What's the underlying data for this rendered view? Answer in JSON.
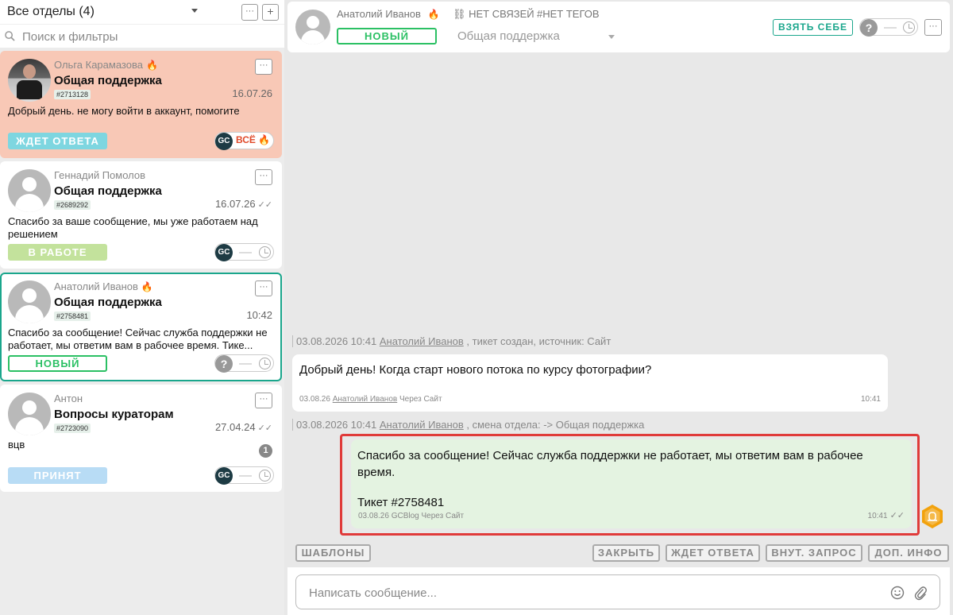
{
  "sidebar": {
    "title": "Все отделы (4)",
    "more_label": "···",
    "add_label": "+",
    "search_placeholder": "Поиск и фильтры"
  },
  "tickets": [
    {
      "name": "Ольга Карамазова",
      "subject": "Общая поддержка",
      "ticket_id": "#2713128",
      "date": "16.07.26",
      "message": "Добрый день. не могу войти в аккаунт, помогите",
      "status": "ЖДЕТ ОТВЕТА",
      "assignee_initials": "GC",
      "assignee_tag": "ВСЁ",
      "more": "···"
    },
    {
      "name": "Геннадий Помолов",
      "subject": "Общая поддержка",
      "ticket_id": "#2689292",
      "date": "16.07.26",
      "message": "Спасибо за ваше сообщение, мы уже работаем над решением",
      "status": "В РАБОТЕ",
      "assignee_initials": "GC",
      "more": "···"
    },
    {
      "name": "Анатолий Иванов",
      "subject": "Общая поддержка",
      "ticket_id": "#2758481",
      "date": "10:42",
      "message": "Спасибо за сообщение! Сейчас служба поддержки не работает, мы ответим вам в рабочее время. Тике...",
      "status": "НОВЫЙ",
      "assignee_initials": "?",
      "more": "···"
    },
    {
      "name": "Антон",
      "subject": "Вопросы кураторам",
      "ticket_id": "#2723090",
      "date": "27.04.24",
      "message": "вцв",
      "unread": "1",
      "status": "ПРИНЯТ",
      "assignee_initials": "GC",
      "more": "···"
    }
  ],
  "header": {
    "name": "Анатолий Иванов",
    "links": "НЕТ СВЯЗЕЙ",
    "tags": "#НЕТ ТЕГОВ",
    "status": "НОВЫЙ",
    "department": "Общая поддержка",
    "take_label": "ВЗЯТЬ СЕБЕ",
    "assignee_initials": "?",
    "more": "···"
  },
  "chat": {
    "event1": {
      "datetime": "03.08.2026 10:41",
      "author": "Анатолий Иванов",
      "text": ", тикет создан, источник: Сайт"
    },
    "incoming": {
      "text": "Добрый день! Когда старт нового потока по курсу фотографии?",
      "date": "03.08.26",
      "author": "Анатолий Иванов",
      "via": "Через Сайт",
      "time": "10:41"
    },
    "event2": {
      "datetime": "03.08.2026 10:41",
      "author": "Анатолий Иванов",
      "text": ", смена отдела: -> Общая поддержка"
    },
    "outgoing": {
      "line1": "Спасибо за сообщение! Сейчас служба поддержки не работает, мы ответим вам в рабочее время.",
      "line2": "Тикет #2758481",
      "date": "03.08.26",
      "author": "GCBlog",
      "via": "Через Сайт",
      "time": "10:41"
    }
  },
  "actions": {
    "templates": "ШАБЛОНЫ",
    "close": "ЗАКРЫТЬ",
    "wait": "ЖДЕТ ОТВЕТА",
    "internal": "ВНУТ. ЗАПРОС",
    "info": "ДОП. ИНФО"
  },
  "composer": {
    "placeholder": "Написать сообщение..."
  },
  "colors": {
    "accent": "#1aa68c",
    "new_status": "#2bc064",
    "active_card": "#f8c8b6",
    "highlight": "#e03a3a"
  }
}
